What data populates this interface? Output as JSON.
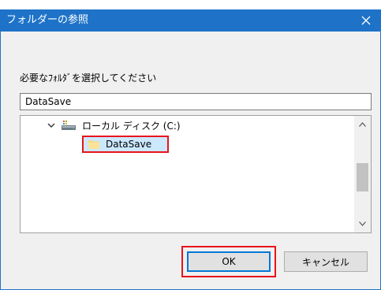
{
  "dialog": {
    "title": "フォルダーの参照",
    "prompt": "必要なﾌｫﾙﾀﾞを選択してください",
    "path_value": "DataSave",
    "tree": {
      "drive_label": "ローカル ディスク (C:)",
      "selected_folder": "DataSave"
    },
    "buttons": {
      "ok": "OK",
      "cancel": "キャンセル"
    }
  },
  "colors": {
    "titlebar": "#1e73c8",
    "selection": "#cce8ff",
    "highlight_annotation": "#e8141a"
  },
  "icons": [
    "close-icon",
    "chevron-down-icon",
    "drive-icon",
    "folder-icon",
    "scroll-up-icon",
    "scroll-down-icon"
  ]
}
